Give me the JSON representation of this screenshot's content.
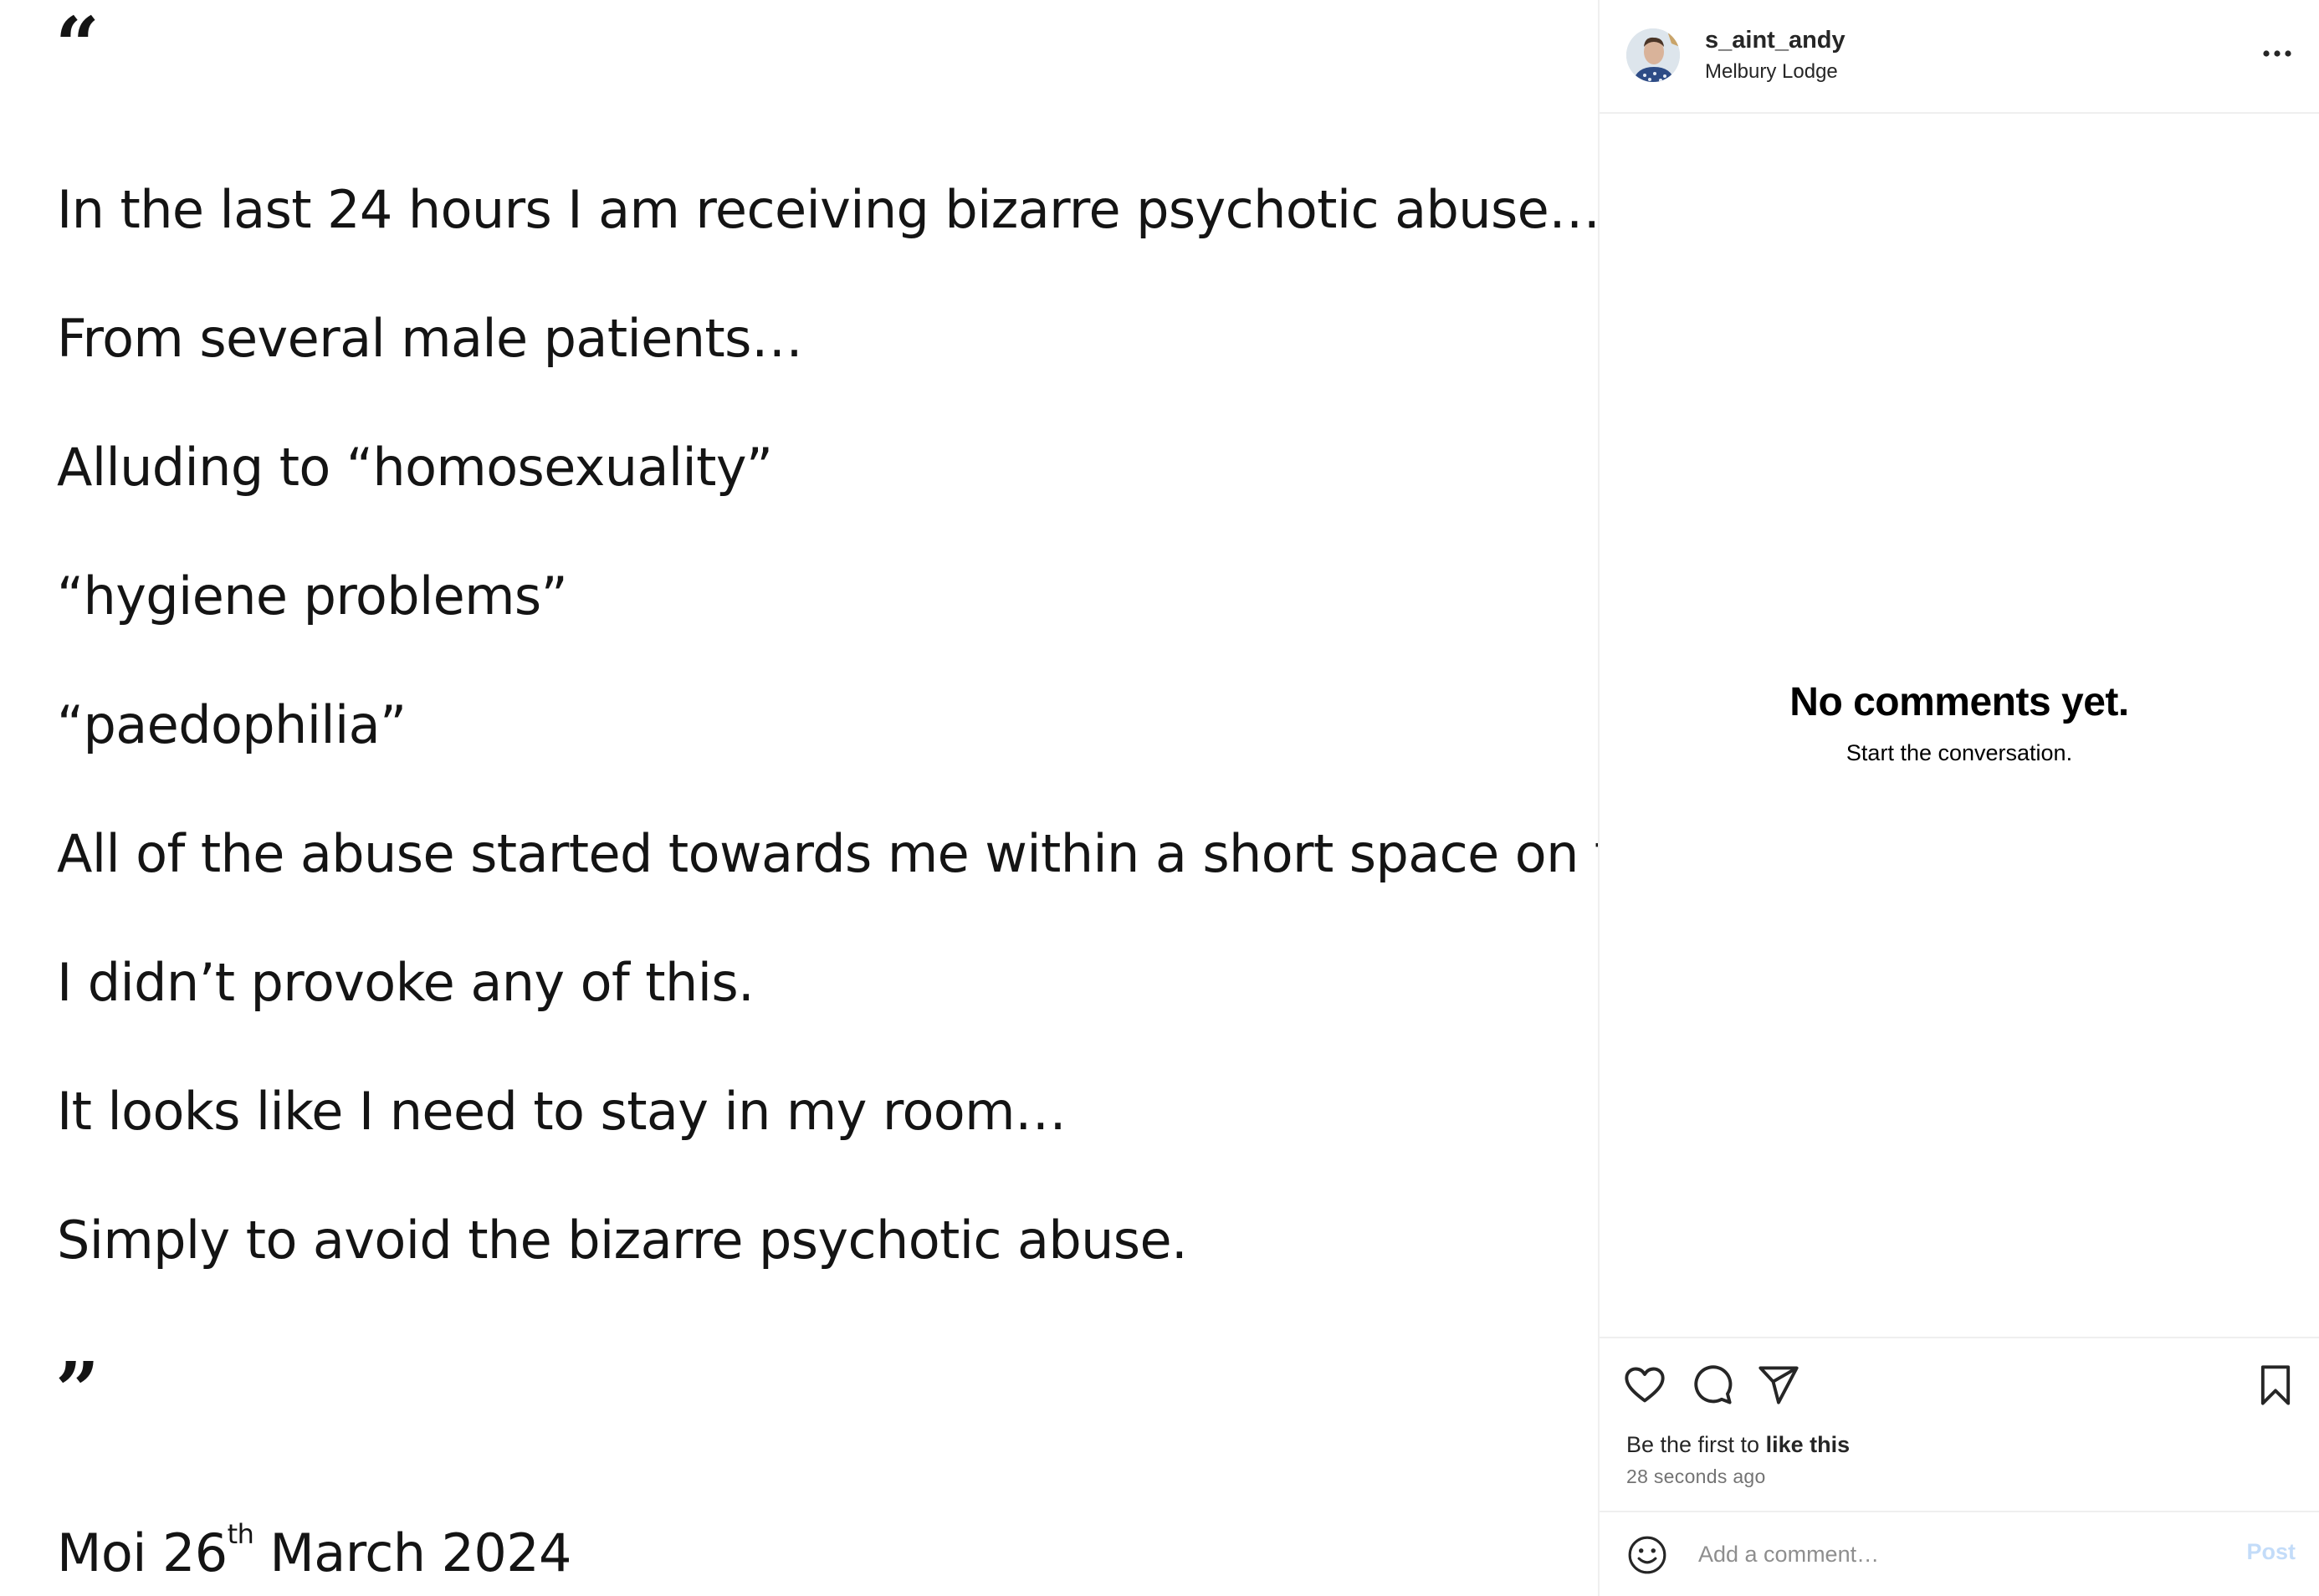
{
  "post_image": {
    "open_quote": "“",
    "lines": [
      "In the last 24 hours I am receiving bizarre psychotic abuse…",
      "From several male patients…",
      "Alluding to “homosexuality”",
      "“hygiene problems”",
      "“paedophilia”",
      "All of the abuse started towards me within a short space on time.",
      "I didn’t provoke any of this.",
      "It looks like I need to stay in my room…",
      "Simply to avoid the bizarre psychotic abuse."
    ],
    "close_quote": "”",
    "signature_prefix": "Moi 26",
    "signature_suffix": "th",
    "signature_rest": " March 2024"
  },
  "header": {
    "username": "s_aint_andy",
    "location": "Melbury Lodge",
    "more_icon": "more-horizontal-icon"
  },
  "comments": {
    "empty_title": "No comments yet.",
    "empty_subtitle": "Start the conversation."
  },
  "actions": {
    "icons": [
      "heart-icon",
      "comment-icon",
      "share-icon",
      "bookmark-icon"
    ],
    "likes_prefix": "Be the first to ",
    "likes_bold": "like this",
    "timestamp": "28 seconds ago"
  },
  "comment_bar": {
    "placeholder": "Add a comment…",
    "post_label": "Post",
    "emoji_icon": "emoji-icon"
  },
  "colors": {
    "post_button_disabled": "#c3dcf9",
    "border": "#efefef",
    "secondary_text": "#737373"
  }
}
